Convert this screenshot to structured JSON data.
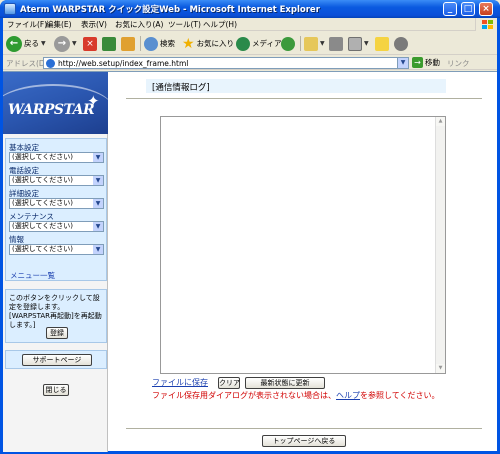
{
  "window": {
    "title": "Aterm WARPSTAR クイック設定Web - Microsoft Internet Explorer",
    "min_label": "_",
    "max_label": "□",
    "close_label": "×"
  },
  "menubar": {
    "items": [
      "ファイル(F)",
      "編集(E)",
      "表示(V)",
      "お気に入り(A)",
      "ツール(T)",
      "ヘルプ(H)"
    ]
  },
  "toolbar": {
    "back": "戻る",
    "search": "検索",
    "favorites": "お気に入り",
    "media": "メディア"
  },
  "address": {
    "label": "アドレス(D)",
    "url": "http://web.setup/index_frame.html",
    "go": "移動",
    "links": "リンク"
  },
  "sidebar": {
    "logo": "WARPSTAR",
    "groups": [
      {
        "label": "基本設定",
        "value": "(選択してください)"
      },
      {
        "label": "電話設定",
        "value": "(選択してください)"
      },
      {
        "label": "詳細設定",
        "value": "(選択してください)"
      },
      {
        "label": "メンテナンス",
        "value": "(選択してください)"
      },
      {
        "label": "情報",
        "value": "(選択してください)"
      }
    ],
    "menu_link": "メニュー一覧",
    "register_text": "このボタンをクリックして設定を登録します。[WARPSTAR再起動]を再起動します。]",
    "register_button": "登録",
    "support_button": "サポートページ",
    "close_button": "閉じる"
  },
  "main": {
    "title": "[通信情報ログ]",
    "log_text": "",
    "save_link": "ファイルに保存",
    "clear_button": "クリア",
    "refresh_button": "最新状態に更新",
    "msg_before": "ファイル保存用ダイアログが表示されない場合は、",
    "msg_link": "ヘルプ",
    "msg_after": "を参照してください。",
    "top_button": "トップページへ戻る"
  },
  "colors": {
    "titlebar": "#0a5ae0",
    "sidebar_panel": "#dbeeff",
    "logo_bg": "#2b57b0",
    "message": "#d10000",
    "link": "#1a3faf"
  }
}
